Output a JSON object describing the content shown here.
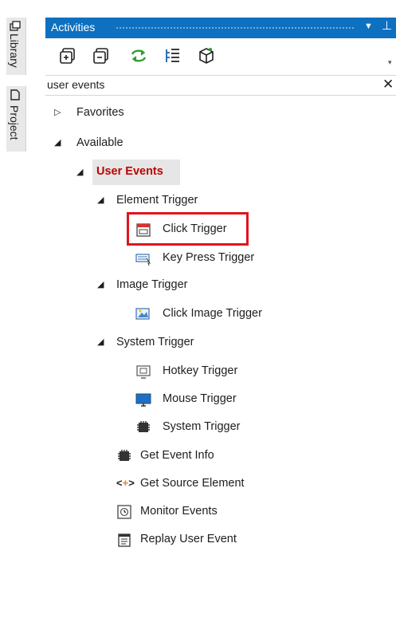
{
  "sidebar": {
    "tabs": [
      {
        "label": "Library",
        "icon": "library-icon"
      },
      {
        "label": "Project",
        "icon": "project-icon"
      }
    ]
  },
  "panel": {
    "title": "Activities",
    "dropdown_icon": "dropdown-arrow-icon",
    "pin_icon": "pin-icon"
  },
  "toolbar": {
    "buttons": [
      "expand-all-icon",
      "collapse-all-icon",
      "refresh-icon",
      "filter-list-icon",
      "package-icon"
    ]
  },
  "search": {
    "value": "user events",
    "clear_icon": "close-icon"
  },
  "tree": {
    "favorites": "Favorites",
    "available": "Available",
    "user_events": "User Events",
    "element_trigger": "Element Trigger",
    "click_trigger": "Click Trigger",
    "key_press_trigger": "Key Press Trigger",
    "image_trigger": "Image Trigger",
    "click_image_trigger": "Click Image Trigger",
    "system_trigger_group": "System Trigger",
    "hotkey_trigger": "Hotkey Trigger",
    "mouse_trigger": "Mouse Trigger",
    "system_trigger": "System Trigger",
    "get_event_info": "Get Event Info",
    "get_source_element": "Get Source Element",
    "monitor_events": "Monitor Events",
    "replay_user_event": "Replay User Event"
  },
  "colors": {
    "title_bar": "#0e70c0",
    "selected_text": "#c00000",
    "highlight_box": "#e0141e"
  }
}
